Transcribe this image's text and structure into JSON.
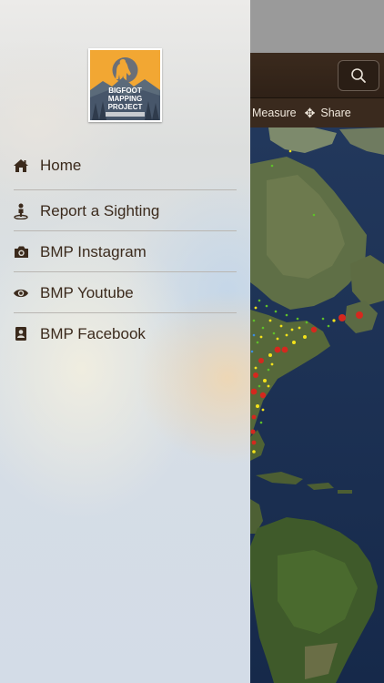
{
  "drawer": {
    "logo": {
      "lines": [
        "BIGFOOT",
        "MAPPING",
        "PROJECT"
      ],
      "icon": "bigfoot-logo"
    },
    "menu": [
      {
        "label": "Home",
        "icon": "home-icon"
      },
      {
        "label": "Report a Sighting",
        "icon": "person-pin-icon"
      },
      {
        "label": "BMP Instagram",
        "icon": "camera-icon"
      },
      {
        "label": "BMP Youtube",
        "icon": "eye-icon"
      },
      {
        "label": "BMP Facebook",
        "icon": "contact-book-icon"
      }
    ]
  },
  "map": {
    "toolbar": {
      "measure_label": "Measure",
      "share_label": "Share"
    },
    "search_icon": "search-icon"
  },
  "colors": {
    "header_brown": "#3b2a1d",
    "toolbar_brown": "#3a2a1e",
    "menu_text": "#3b2a1c",
    "logo_orange": "#f2a733",
    "logo_slate": "#5b6b7a",
    "sighting_red": "#d5281e",
    "sighting_yellow": "#f3e21a",
    "sighting_green": "#5fbf2a"
  }
}
